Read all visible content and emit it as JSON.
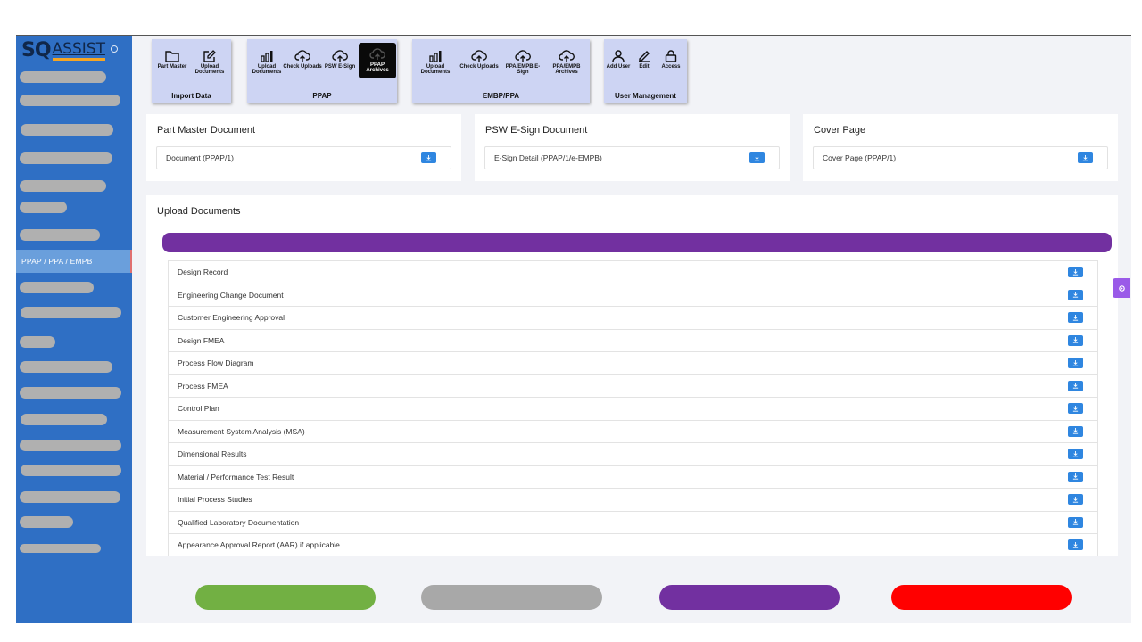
{
  "brand": {
    "sq": "SQ",
    "assist": "ASSIST"
  },
  "sidebar": {
    "active_item": "PPAP / PPA / EMPB"
  },
  "toolbar": {
    "import_data": {
      "title": "Import Data",
      "items": [
        {
          "label": "Part Master",
          "icon": "folder-icon"
        },
        {
          "label": "Upload Documents",
          "icon": "edit-icon"
        }
      ]
    },
    "ppap": {
      "title": "PPAP",
      "items": [
        {
          "label": "Upload Documents",
          "icon": "bar-chart-icon"
        },
        {
          "label": "Check Uploads",
          "icon": "cloud-upload-icon"
        },
        {
          "label": "PSW E-Sign",
          "icon": "cloud-upload-icon"
        },
        {
          "label": "PPAP Archives",
          "icon": "cloud-upload-icon"
        }
      ]
    },
    "embp": {
      "title": "EMBP/PPA",
      "items": [
        {
          "label": "Upload Documents",
          "icon": "bar-chart-icon"
        },
        {
          "label": "Check Uploads",
          "icon": "cloud-upload-icon"
        },
        {
          "label": "PPA/EMPB E-Sign",
          "icon": "cloud-upload-icon"
        },
        {
          "label": "PPA/EMPB Archives",
          "icon": "cloud-upload-icon"
        }
      ]
    },
    "user_mgmt": {
      "title": "User Management",
      "items": [
        {
          "label": "Add User",
          "icon": "user-icon"
        },
        {
          "label": "Edit",
          "icon": "pen-icon"
        },
        {
          "label": "Access",
          "icon": "lock-icon"
        }
      ]
    }
  },
  "cards": [
    {
      "title": "Part Master Document",
      "field": "Document (PPAP/1)"
    },
    {
      "title": "PSW E-Sign Document",
      "field": "E-Sign Detail (PPAP/1/e-EMPB)"
    },
    {
      "title": "Cover Page",
      "field": "Cover Page (PPAP/1)"
    }
  ],
  "upload": {
    "title": "Upload Documents",
    "documents": [
      "Design Record",
      "Engineering Change Document",
      "Customer Engineering Approval",
      "Design FMEA",
      "Process Flow Diagram",
      "Process FMEA",
      "Control Plan",
      "Measurement System Analysis (MSA)",
      "Dimensional Results",
      "Material / Performance Test Result",
      "Initial Process Studies",
      "Qualified Laboratory Documentation",
      "Appearance Approval Report (AAR) if applicable"
    ]
  },
  "colors": {
    "green": "#72b043",
    "gray": "#a8a8a8",
    "purple": "#7230a0",
    "red": "#ff0000",
    "blue": "#2f86e0"
  }
}
